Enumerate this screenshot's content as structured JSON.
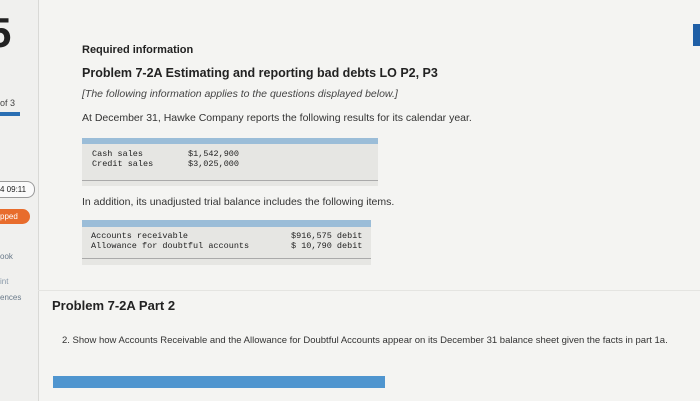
{
  "sidebar": {
    "question_number": "5",
    "progress_label": "of 3",
    "timer": "4 09:11",
    "status_badge": "pped",
    "ebook_label": "ook",
    "print_label": "int",
    "references_label": "ences"
  },
  "header": {
    "required_info": "Required information",
    "problem_title": "Problem 7-2A Estimating and reporting bad debts LO P2, P3",
    "applies_note": "[The following information applies to the questions displayed below.]"
  },
  "intro": "At December 31, Hawke Company reports the following results for its calendar year.",
  "sales_table": {
    "rows": [
      {
        "label": "Cash sales",
        "amount": "$1,542,900"
      },
      {
        "label": "Credit sales",
        "amount": "$3,025,000"
      }
    ]
  },
  "addition_text": "In addition, its unadjusted trial balance includes the following items.",
  "trial_table": {
    "rows": [
      {
        "label": "Accounts receivable",
        "amount": "$916,575 debit"
      },
      {
        "label": "Allowance for doubtful accounts",
        "amount": "$ 10,790 debit"
      }
    ]
  },
  "part": {
    "title": "Problem 7-2A Part 2",
    "instruction": "2. Show how Accounts Receivable and the Allowance for Doubtful Accounts appear on its December 31 balance sheet given the facts in part 1a."
  },
  "colors": {
    "accent": "#2a6fb3",
    "table_header": "#9bbdd8",
    "skipped_badge": "#e86c2c",
    "answer_bar": "#4f95cf"
  }
}
